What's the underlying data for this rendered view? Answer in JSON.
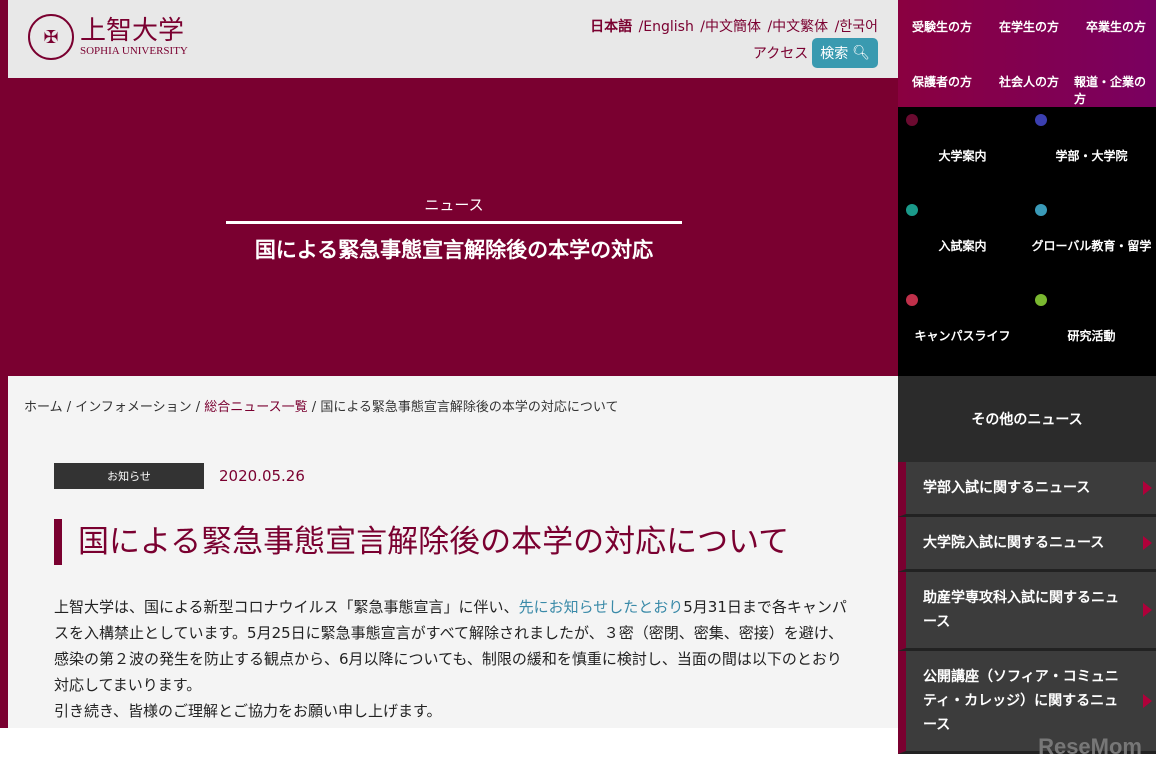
{
  "header": {
    "logo_jp": "上智大学",
    "logo_en": "SOPHIA UNIVERSITY",
    "languages": [
      "日本語",
      "/English",
      "/中文簡体",
      "/中文繁体",
      "/한국어"
    ],
    "access": "アクセス",
    "search": "検索"
  },
  "top_nav": [
    "受験生の方",
    "在学生の方",
    "卒業生の方",
    "保護者の方",
    "社会人の方",
    "報道・企業の方"
  ],
  "category_nav": [
    {
      "label": "大学案内",
      "color": "#6b0a30"
    },
    {
      "label": "学部・大学院",
      "color": "#3b3fb0"
    },
    {
      "label": "入試案内",
      "color": "#1a9a8a"
    },
    {
      "label": "グローバル教育・留学",
      "color": "#3a9ab8"
    },
    {
      "label": "キャンパスライフ",
      "color": "#c0304a"
    },
    {
      "label": "研究活動",
      "color": "#7ab830"
    }
  ],
  "hero": {
    "category": "ニュース",
    "title": "国による緊急事態宣言解除後の本学の対応"
  },
  "breadcrumb": [
    "ホーム",
    "インフォメーション",
    "総合ニュース一覧",
    "国による緊急事態宣言解除後の本学の対応について"
  ],
  "article": {
    "badge": "お知らせ",
    "date": "2020.05.26",
    "title": "国による緊急事態宣言解除後の本学の対応について",
    "p1_pre": "上智大学は、国による新型コロナウイルス「緊急事態宣言」に伴い、",
    "p1_link": "先にお知らせしたとおり",
    "p1_post": "5月31日まで各キャンパスを入構禁止としています。5月25日に緊急事態宣言がすべて解除されましたが、３密（密閉、密集、密接）を避け、感染の第２波の発生を防止する観点から、6月以降についても、制限の緩和を慎重に検討し、当面の間は以下のとおり対応してまいります。",
    "p2": "引き続き、皆様のご理解とご協力をお願い申し上げます。"
  },
  "sidebar": {
    "heading": "その他のニュース",
    "items": [
      "学部入試に関するニュース",
      "大学院入試に関するニュース",
      "助産学専攻科入試に関するニュース",
      "公開講座（ソフィア・コミュニティ・カレッジ）に関するニュース"
    ]
  },
  "watermark": "ReseMom"
}
